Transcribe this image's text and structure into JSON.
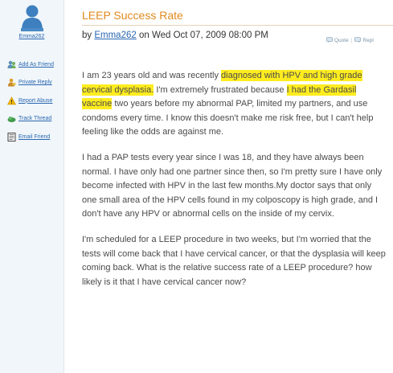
{
  "user": {
    "username": "Emma262"
  },
  "sidebar_actions": [
    {
      "label": "Add As Friend",
      "icon": "add-friend-icon"
    },
    {
      "label": "Private Reply",
      "icon": "private-reply-icon"
    },
    {
      "label": "Report Abuse",
      "icon": "warning-icon"
    },
    {
      "label": "Track Thread",
      "icon": "track-thread-icon"
    },
    {
      "label": "Email Friend",
      "icon": "email-icon"
    }
  ],
  "post": {
    "title": "LEEP Success Rate",
    "by_prefix": "by ",
    "author": "Emma262",
    "date_text": " on Wed Oct 07, 2009 08:00 PM",
    "actions": {
      "quote": "Quote",
      "reply": "Repl"
    },
    "paragraph1": {
      "part1": "I am 23 years old and was recently ",
      "highlight1": "diagnosed with HPV and high grade cervical dysplasia.",
      "part2": " I'm extremely frustrated because ",
      "highlight2": "I had the Gardasil vaccine",
      "part3": " two years before my abnormal PAP, limited my partners, and use condoms every time. I know this doesn't make me risk free, but I can't help feeling like the odds are against me."
    },
    "paragraph2": "I had a PAP tests every year since I was 18, and they have always been normal. I have only had one partner since then, so I'm pretty sure I have only become infected with HPV in the last few months.My doctor says that only one small area of the HPV cells found in my colposcopy is high grade, and I don't have any HPV or abnormal cells on the inside of my cervix.",
    "paragraph3": "I'm scheduled for a LEEP procedure in two weeks, but I'm worried that the tests will come back that I have cervical cancer, or that the dysplasia will keep coming back. What is the relative success rate of a LEEP procedure? how likely is it that I have cervical cancer now?"
  },
  "colors": {
    "title": "#e08a1e",
    "link": "#2a67b1",
    "highlight": "#ffec1f",
    "sidebar_bg": "#f0f6fa"
  }
}
